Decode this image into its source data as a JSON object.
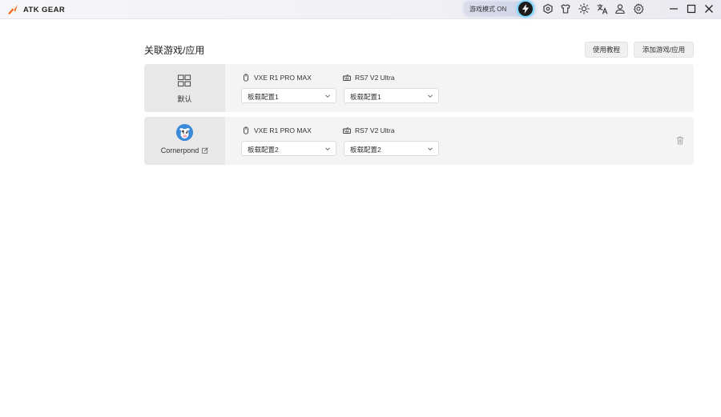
{
  "app": {
    "brand": "ATK GEAR",
    "game_mode_label": "游戏模式 ON",
    "icons": [
      "shield-icon",
      "shirt-icon",
      "sun-icon",
      "translate-icon",
      "user-icon",
      "settings-icon",
      "minimize-icon",
      "maximize-icon",
      "close-icon"
    ]
  },
  "main": {
    "title": "关联游戏/应用",
    "tutorial_label": "使用教程",
    "add_label": "添加游戏/应用",
    "rows": [
      {
        "name": "默认",
        "device_1": "VXE R1 PRO MAX",
        "device_2": "RS7 V2 Ultra",
        "profile_1": "板载配置1",
        "profile_2": "板载配置1"
      },
      {
        "name": "Cornerpond",
        "device_1": "VXE R1 PRO MAX",
        "device_2": "RS7 V2 Ultra",
        "profile_1": "板载配置2",
        "profile_2": "板载配置2"
      }
    ]
  },
  "colors": {
    "accent_orange": "#f26b1d",
    "toggle_glow": "#4cc2ff",
    "row_bg": "#f4f4f4",
    "row_left_bg": "#e8e8e8"
  }
}
